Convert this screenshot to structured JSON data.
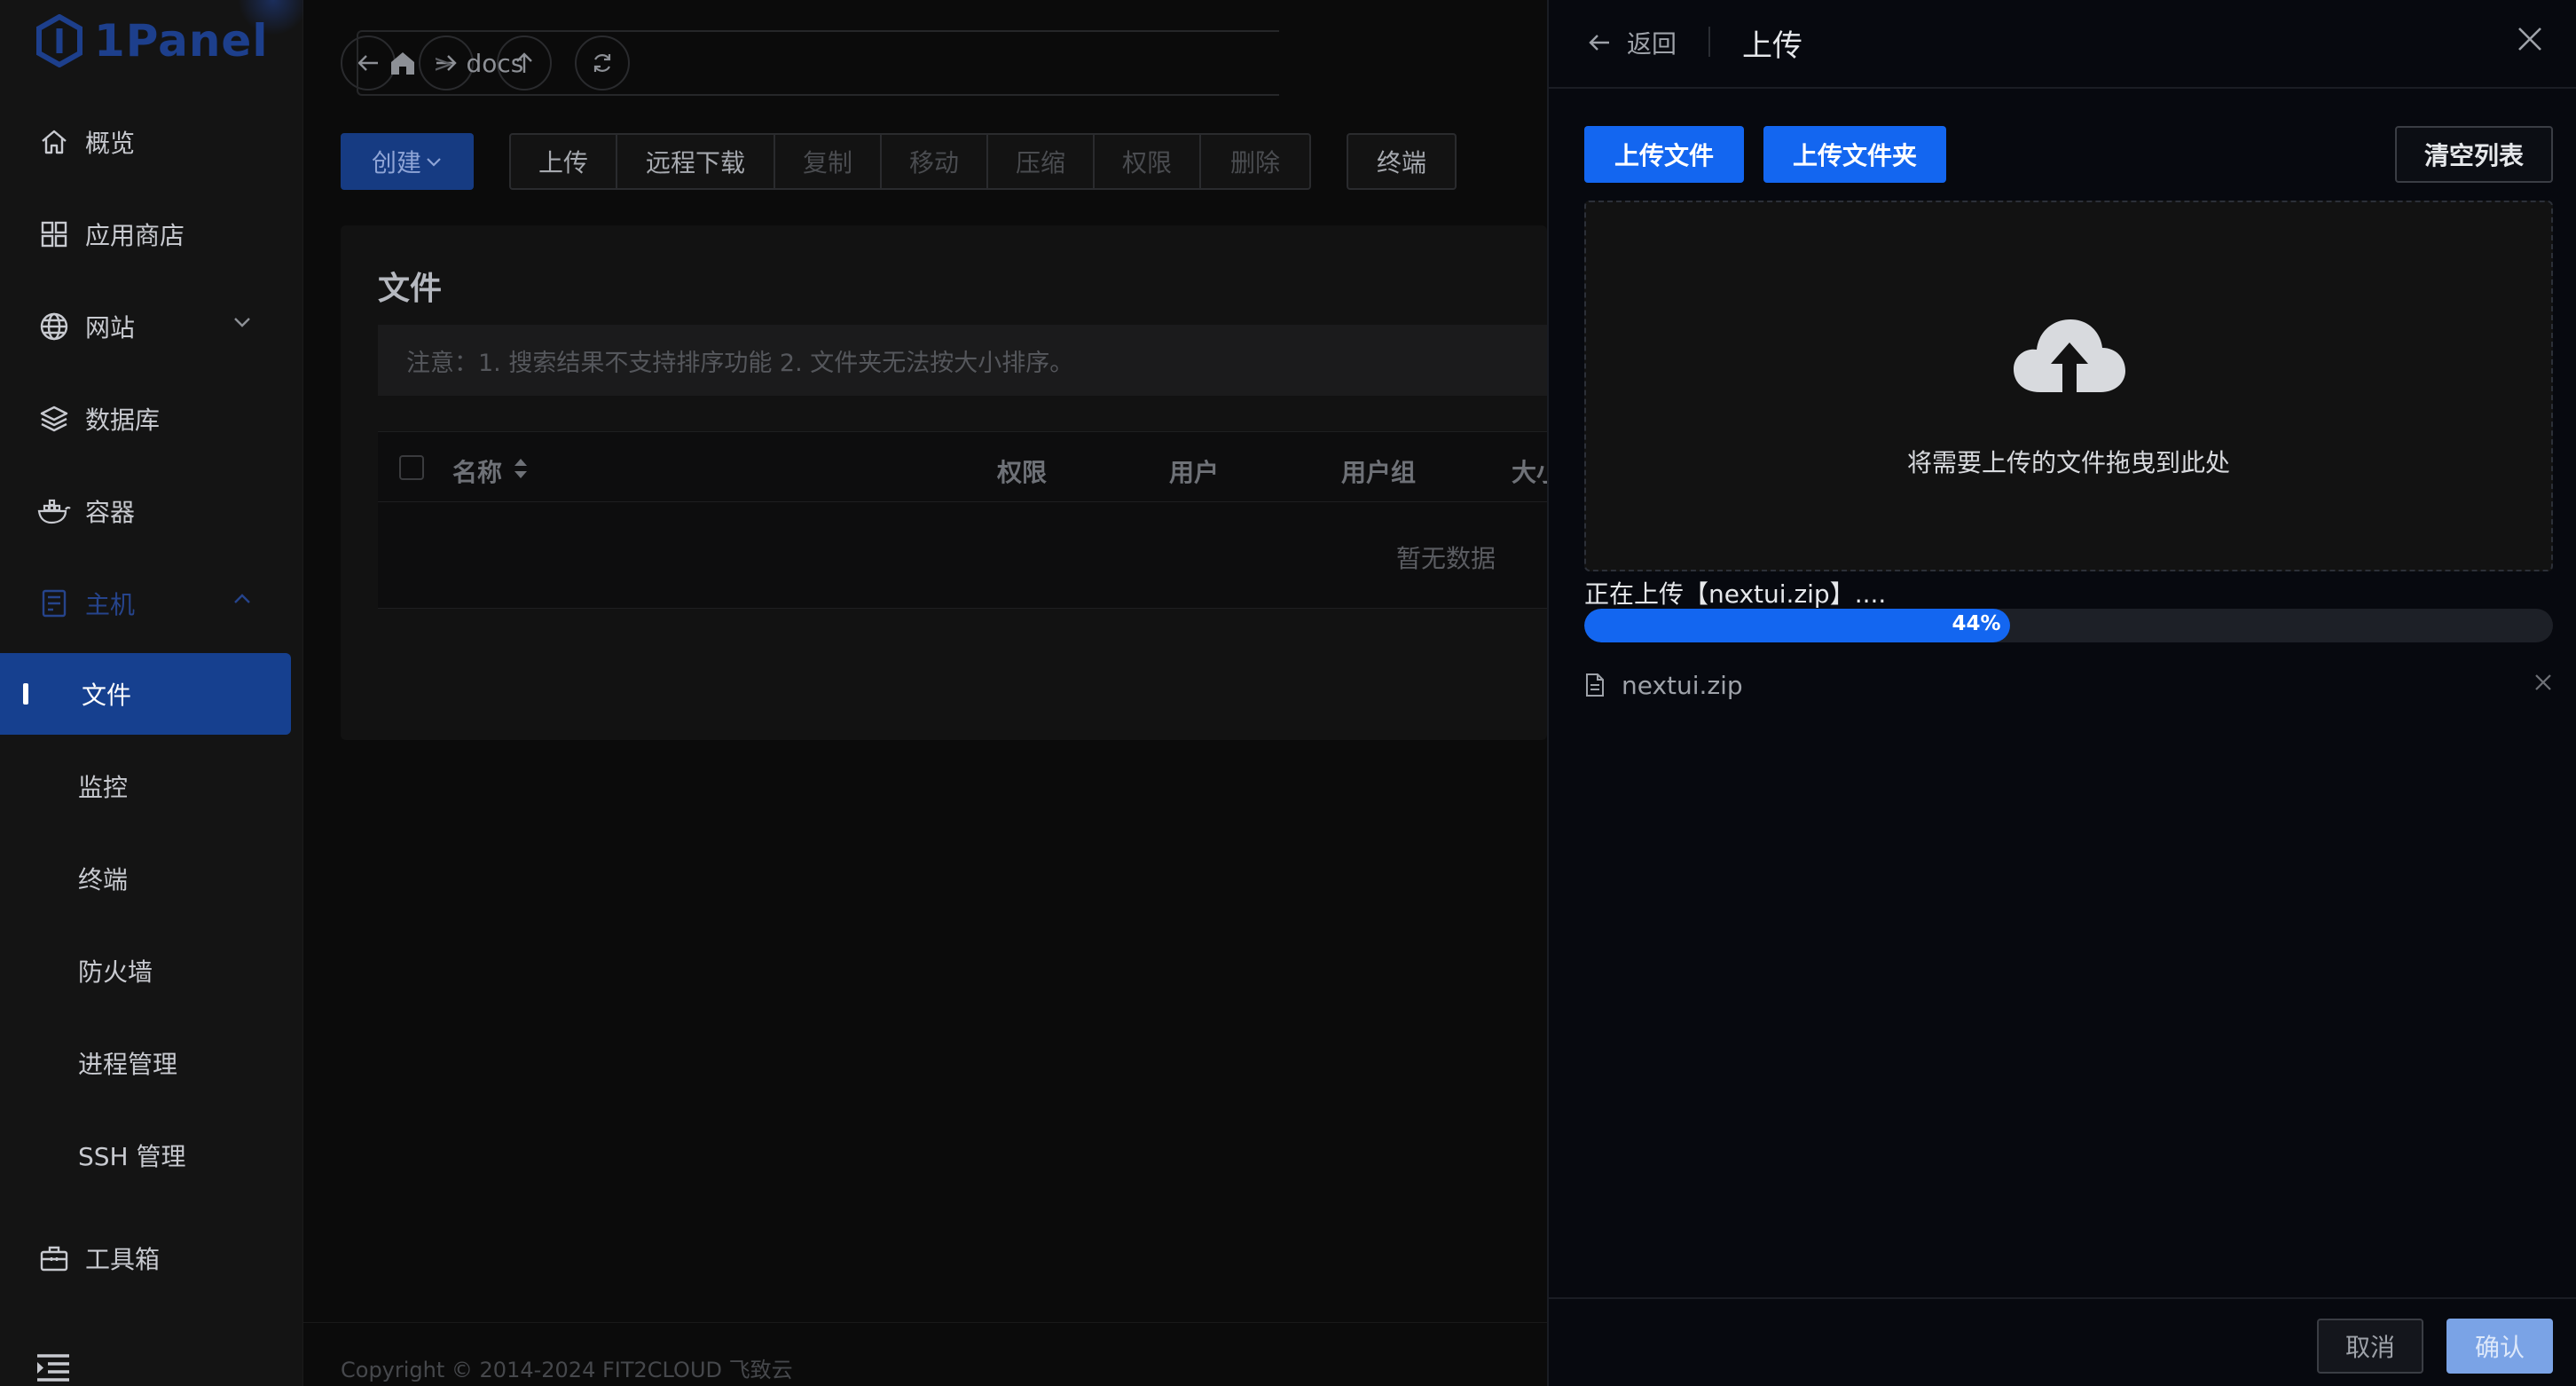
{
  "app": {
    "logo_text": "1Panel"
  },
  "sidebar": {
    "items": [
      {
        "label": "概览",
        "icon": "home-icon"
      },
      {
        "label": "应用商店",
        "icon": "grid-icon"
      },
      {
        "label": "网站",
        "icon": "globe-icon"
      },
      {
        "label": "数据库",
        "icon": "layers-icon"
      },
      {
        "label": "容器",
        "icon": "docker-icon"
      },
      {
        "label": "主机",
        "icon": "server-icon"
      }
    ],
    "host_children": [
      {
        "label": "文件"
      },
      {
        "label": "监控"
      },
      {
        "label": "终端"
      },
      {
        "label": "防火墙"
      },
      {
        "label": "进程管理"
      },
      {
        "label": "SSH 管理"
      }
    ],
    "toolbox": {
      "label": "工具箱",
      "icon": "toolbox-icon"
    }
  },
  "path": {
    "current": "docs"
  },
  "toolbar": {
    "create": "创建",
    "upload": "上传",
    "remote_download": "远程下载",
    "copy": "复制",
    "move": "移动",
    "compress": "压缩",
    "permission": "权限",
    "delete": "删除",
    "terminal": "终端"
  },
  "files": {
    "title": "文件",
    "notice": "注意：1. 搜索结果不支持排序功能 2. 文件夹无法按大小排序。",
    "columns": [
      "名称",
      "权限",
      "用户",
      "用户组",
      "大小"
    ],
    "empty": "暂无数据"
  },
  "footer": {
    "copyright": "Copyright © 2014-2024 FIT2CLOUD 飞致云"
  },
  "drawer": {
    "back": "返回",
    "title": "上传",
    "upload_file": "上传文件",
    "upload_folder": "上传文件夹",
    "clear_list": "清空列表",
    "drop_hint": "将需要上传的文件拖曳到此处",
    "status": "正在上传【nextui.zip】....",
    "progress_text": "44%",
    "progress_value": 0.44,
    "file_name": "nextui.zip",
    "cancel": "取消",
    "confirm": "确认"
  },
  "colors": {
    "accent": "#1366f0",
    "active_nav": "#16408f"
  }
}
